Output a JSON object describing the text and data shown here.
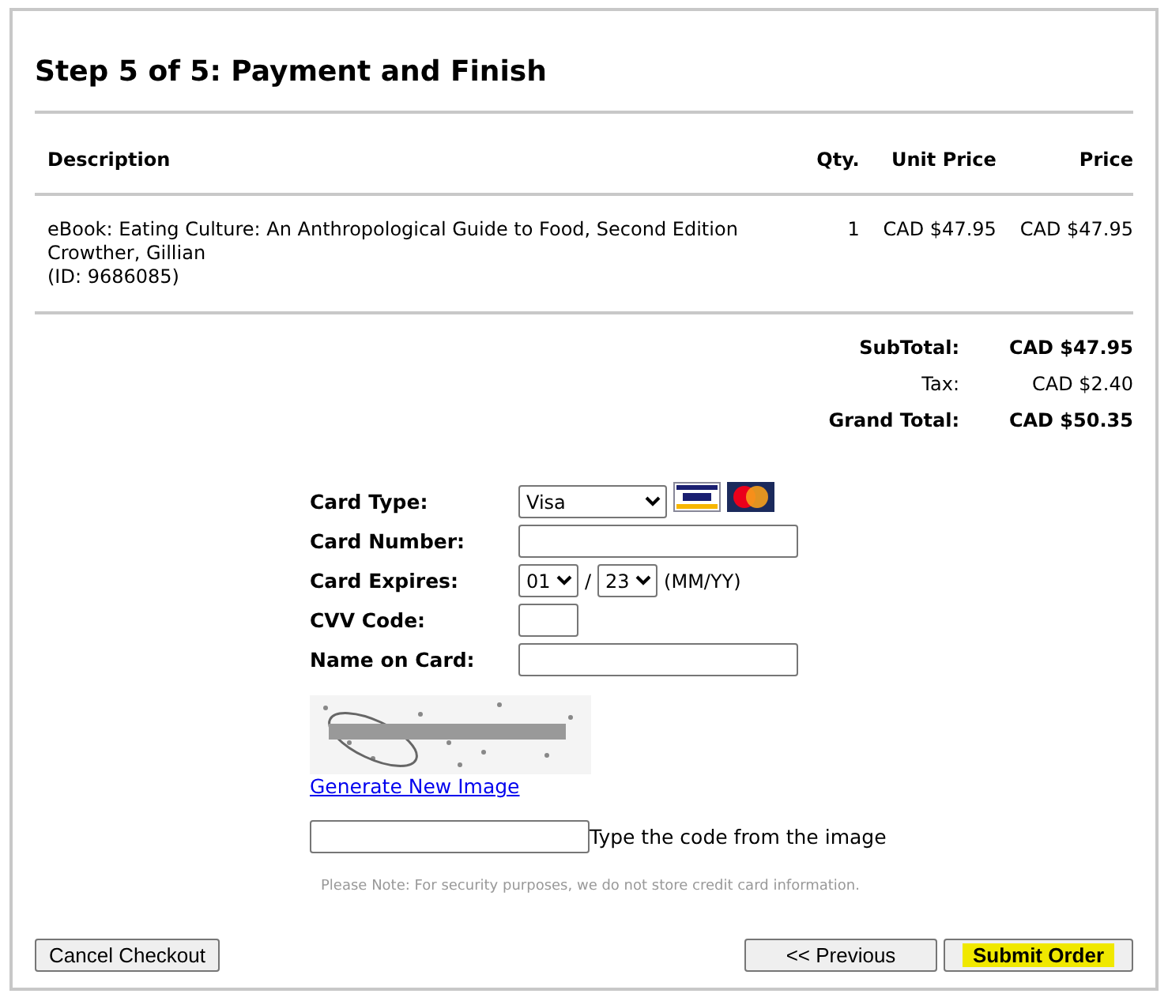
{
  "title": "Step 5 of 5: Payment and Finish",
  "table": {
    "columns": [
      "Description",
      "Qty.",
      "Unit Price",
      "Price"
    ],
    "rows": [
      {
        "description": [
          "eBook: Eating Culture: An Anthropological Guide to Food, Second Edition",
          "Crowther, Gillian",
          "(ID: 9686085)"
        ],
        "qty": "1",
        "unit_price": "CAD $47.95",
        "price": "CAD $47.95"
      }
    ]
  },
  "totals": [
    {
      "label": "SubTotal:",
      "value": "CAD $47.95",
      "bold": true
    },
    {
      "label": "Tax:",
      "value": "CAD $2.40",
      "bold": false
    },
    {
      "label": "Grand Total:",
      "value": "CAD $50.35",
      "bold": true
    }
  ],
  "payment": {
    "card_type_label": "Card Type:",
    "card_type": "Visa",
    "card_number_label": "Card Number:",
    "expires_label": "Card Expires:",
    "month": "01",
    "separator": "/",
    "year": "23",
    "format_hint": "(MM/YY)",
    "cvv_label": "CVV Code:",
    "name_label": "Name on Card:"
  },
  "captcha": {
    "link": "Generate New Image",
    "prompt": "Type the code from the image"
  },
  "note": "Please Note: For security purposes, we do not store credit card information.",
  "buttons": {
    "cancel": "Cancel Checkout",
    "previous": "<< Previous",
    "submit": "Submit Order"
  }
}
